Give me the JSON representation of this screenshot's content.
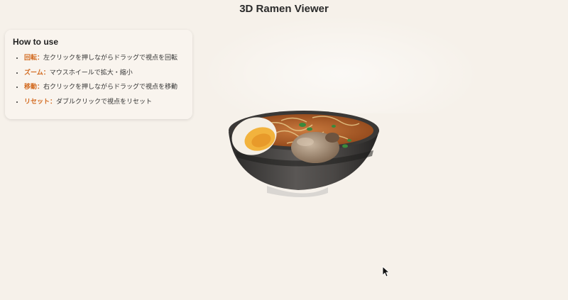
{
  "app": {
    "title": "3D Ramen Viewer"
  },
  "instructions": {
    "heading": "How to use",
    "items": [
      {
        "key": "回転：",
        "text": "左クリックを押しながらドラッグで視点を回転"
      },
      {
        "key": "ズーム：",
        "text": "マウスホイールで拡大・縮小"
      },
      {
        "key": "移動：",
        "text": "右クリックを押しながらドラッグで視点を移動"
      },
      {
        "key": "リセット：",
        "text": "ダブルクリックで視点をリセット"
      }
    ]
  },
  "colors": {
    "background": "#f6f1ea",
    "accent": "#d2691e",
    "bowl": "#3e3c3a",
    "broth": "#b8602c"
  },
  "icons": [
    "cursor-arrow-icon"
  ]
}
